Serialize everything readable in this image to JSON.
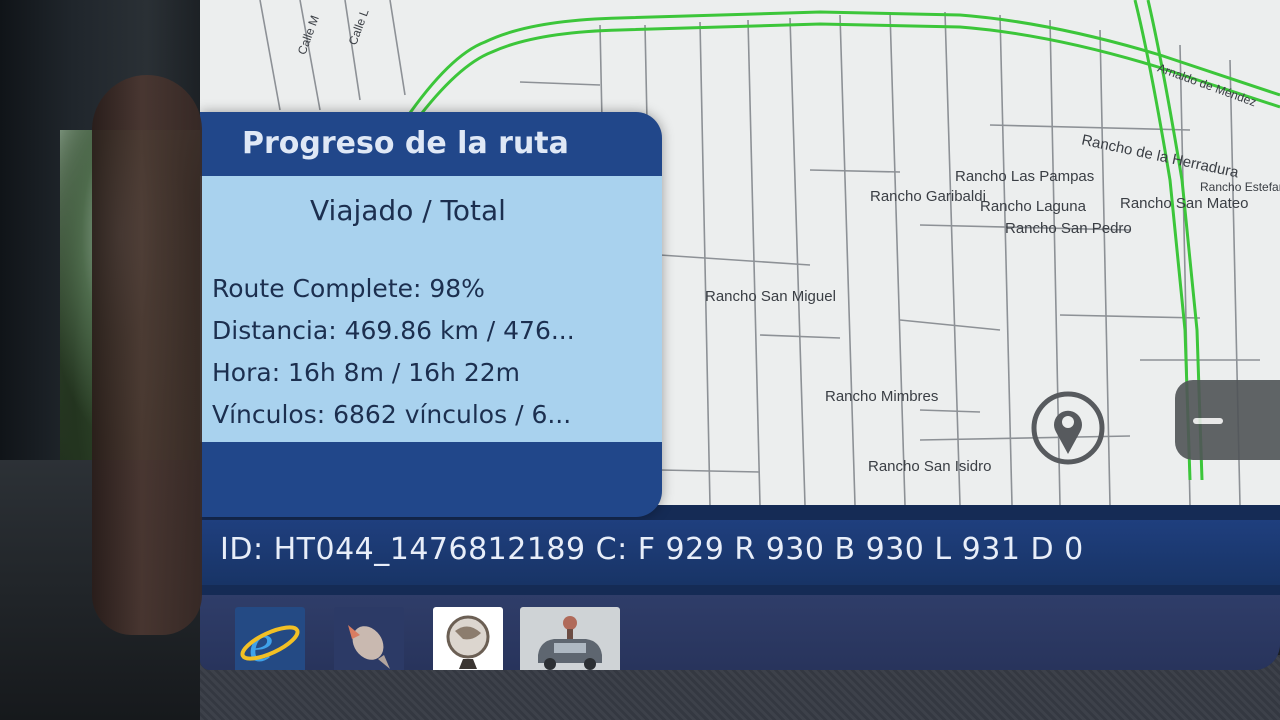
{
  "map": {
    "street_labels": [
      "Calle M",
      "Calle L"
    ],
    "place_labels": [
      "Arnaldo de Méndez",
      "Rancho de la Herradura",
      "Rancho Las Pampas",
      "Rancho Estefani",
      "Rancho San Mateo",
      "Rancho Garibaldi",
      "Rancho Laguna",
      "Rancho San Pedro",
      "Rancho San Miguel",
      "Rancho Mimbres",
      "Rancho San Isidro"
    ],
    "route_color": "#3cc63a"
  },
  "panel": {
    "title": "Progreso de la ruta",
    "subtitle": "Viajado / Total",
    "route_complete": "Route Complete: 98%",
    "route_complete_value": 98,
    "distancia": "Distancia: 469.86 km / 476...",
    "hora": "Hora: 16h 8m / 16h 22m",
    "vinculos": "Vínculos: 6862 vínculos / 6..."
  },
  "status": {
    "text": "ID: HT044_1476812189   C: F 929 R 930 B 930 L 931 D 0"
  },
  "taskbar": {
    "icons": [
      "internet-explorer-icon",
      "fish-app-icon",
      "globe-app-icon",
      "car-navigation-icon"
    ]
  },
  "controls": {
    "location_pin_icon": "location-pin-icon",
    "zoom_out_icon": "minus-icon"
  }
}
